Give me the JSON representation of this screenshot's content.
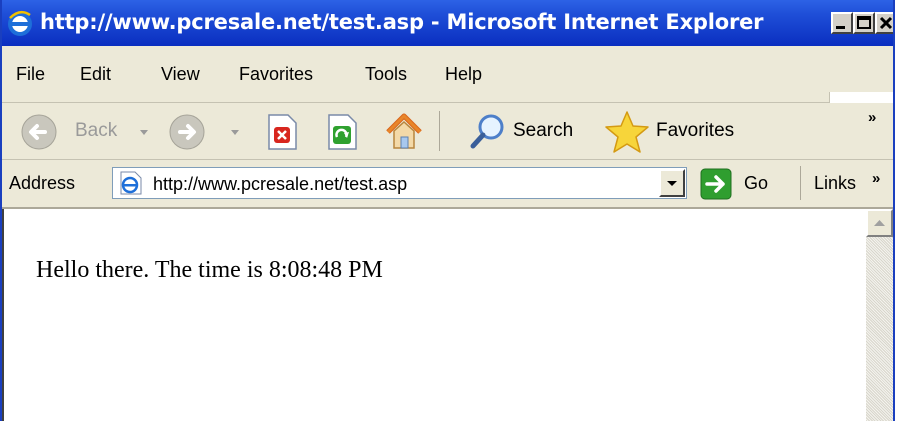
{
  "window": {
    "title": "http://www.pcresale.net/test.asp - Microsoft Internet Explorer"
  },
  "menu": {
    "items": [
      "File",
      "Edit",
      "View",
      "Favorites",
      "Tools",
      "Help"
    ]
  },
  "toolbar": {
    "back_label": "Back",
    "search_label": "Search",
    "favorites_label": "Favorites",
    "more_glyph": "»"
  },
  "address_bar": {
    "label": "Address",
    "url": "http://www.pcresale.net/test.asp",
    "go_label": "Go",
    "links_label": "Links",
    "more_glyph": "»"
  },
  "content": {
    "text": "Hello there. The time is 8:08:48 PM"
  },
  "colors": {
    "titlebar": "#0a2ec0",
    "chrome": "#ece9d8",
    "go_green": "#2f9e2f",
    "home_orange": "#e8862a"
  }
}
